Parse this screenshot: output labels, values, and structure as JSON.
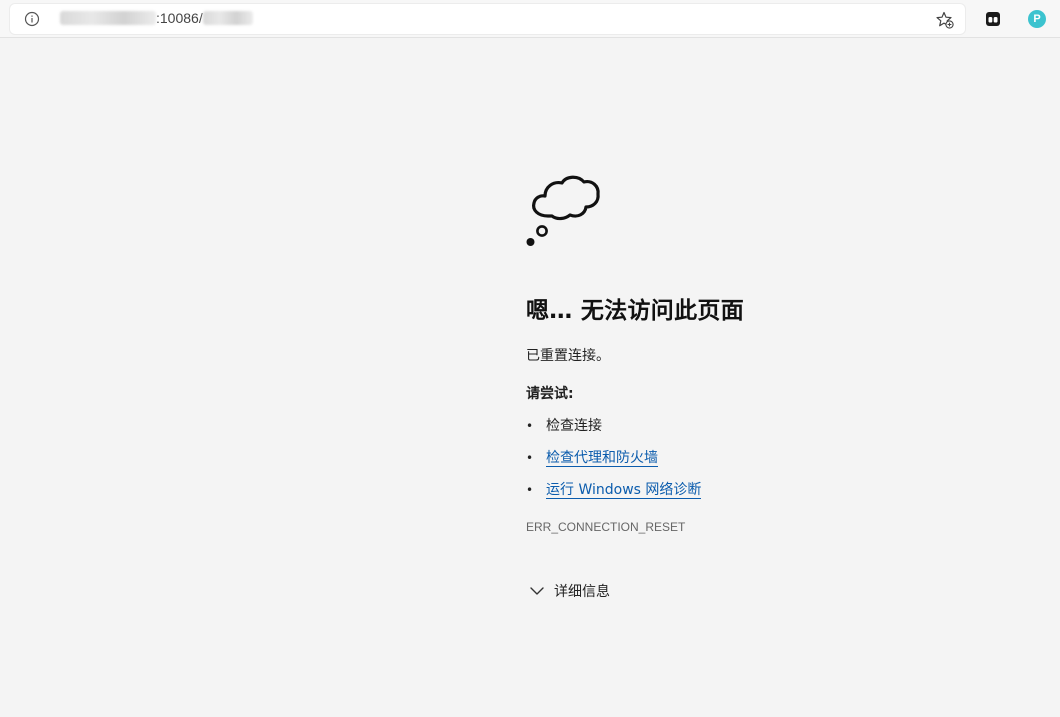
{
  "browser": {
    "url_visible": ":10086/",
    "favorite_icon": "star-add-icon",
    "extension_icon": "extension-icon",
    "profile_initial": "P",
    "profile_color": "#3cc3cf"
  },
  "error_page": {
    "illustration": "thought-cloud-icon",
    "heading": "嗯… 无法访问此页面",
    "reason": "已重置连接。",
    "try_label": "请尝试:",
    "suggestions": [
      {
        "text": "检查连接",
        "is_link": false
      },
      {
        "text": "检查代理和防火墙",
        "is_link": true
      },
      {
        "text": "运行 Windows 网络诊断",
        "is_link": true
      }
    ],
    "error_code": "ERR_CONNECTION_RESET",
    "details_label": "详细信息",
    "link_color": "#0b5cad"
  }
}
